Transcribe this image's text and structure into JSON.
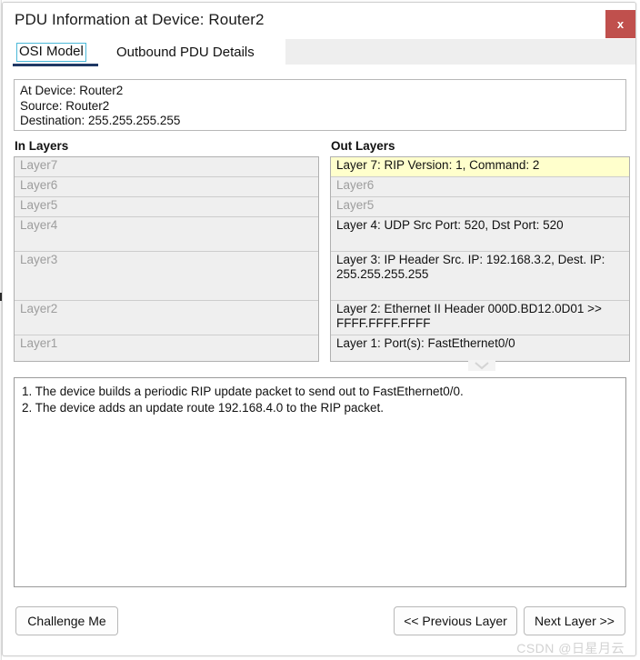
{
  "window": {
    "title": "PDU Information at Device: Router2",
    "close_label": "x",
    "close_icon": "close-icon"
  },
  "tabs": [
    {
      "label": "OSI Model",
      "selected": true
    },
    {
      "label": "Outbound PDU Details",
      "selected": false
    }
  ],
  "info": {
    "at_device": "At Device: Router2",
    "source": "Source: Router2",
    "destination": "Destination: 255.255.255.255"
  },
  "columns": {
    "in_heading": "In Layers",
    "out_heading": "Out Layers"
  },
  "in_layers": [
    {
      "text": "Layer7",
      "dim": true,
      "height": 22
    },
    {
      "text": "Layer6",
      "dim": true,
      "height": 22
    },
    {
      "text": "Layer5",
      "dim": true,
      "height": 22
    },
    {
      "text": "Layer4",
      "dim": true,
      "height": 38
    },
    {
      "text": "Layer3",
      "dim": true,
      "height": 54
    },
    {
      "text": "Layer2",
      "dim": true,
      "height": 38
    },
    {
      "text": "Layer1",
      "dim": true,
      "height": 30
    }
  ],
  "out_layers": [
    {
      "text": "Layer 7: RIP Version: 1, Command: 2",
      "dim": false,
      "highlight": true,
      "height": 22
    },
    {
      "text": "Layer6",
      "dim": true,
      "highlight": false,
      "height": 22
    },
    {
      "text": "Layer5",
      "dim": true,
      "highlight": false,
      "height": 22
    },
    {
      "text": "Layer 4: UDP Src Port: 520, Dst Port: 520",
      "dim": false,
      "highlight": false,
      "height": 38
    },
    {
      "text": "Layer 3: IP Header Src. IP: 192.168.3.2, Dest. IP: 255.255.255.255",
      "dim": false,
      "highlight": false,
      "height": 54
    },
    {
      "text": "Layer 2: Ethernet II Header 000D.BD12.0D01 >> FFFF.FFFF.FFFF",
      "dim": false,
      "highlight": false,
      "height": 38
    },
    {
      "text": "Layer 1: Port(s): FastEthernet0/0",
      "dim": false,
      "highlight": false,
      "height": 30
    }
  ],
  "scroll_chevron_icon": "chevron-down-icon",
  "description": [
    "1. The device builds a periodic RIP update packet to send out to FastEthernet0/0.",
    "2. The device adds an update route 192.168.4.0 to the RIP packet."
  ],
  "footer": {
    "challenge_label": "Challenge Me",
    "previous_label": "<< Previous Layer",
    "next_label": "Next Layer >>"
  },
  "watermark": "CSDN @日星月云",
  "colors": {
    "close_button": "#c0504d",
    "highlight_row": "#ffffcc",
    "row_background": "#efefef",
    "tab_underline": "#1f3864",
    "tab_focus_border": "#4bb8d8",
    "dim_text": "#9d9d9d"
  }
}
